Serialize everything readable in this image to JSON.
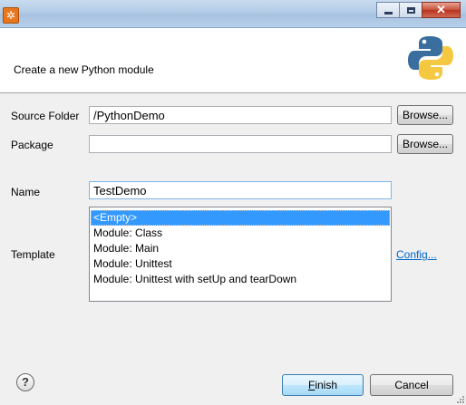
{
  "window": {
    "minimize_label": "minimize",
    "maximize_label": "maximize",
    "close_label": "close",
    "app_icon": "gear-icon"
  },
  "header": {
    "title": "Create a new Python module",
    "logo": "python-logo-icon",
    "logo_colors": {
      "blue": "#3a6e9f",
      "yellow": "#f5c842"
    }
  },
  "form": {
    "source_folder": {
      "label": "Source Folder",
      "value": "/PythonDemo",
      "browse_label": "Browse..."
    },
    "package": {
      "label": "Package",
      "value": "",
      "browse_label": "Browse..."
    },
    "name": {
      "label": "Name",
      "value": "TestDemo"
    },
    "template": {
      "label": "Template",
      "options": [
        "<Empty>",
        "Module: Class",
        "Module: Main",
        "Module: Unittest",
        "Module: Unittest with setUp and tearDown"
      ],
      "selected_index": 0,
      "config_link": "Config..."
    }
  },
  "footer": {
    "help_icon": "help-icon",
    "finish_label": "Finish",
    "cancel_label": "Cancel"
  },
  "colors": {
    "selection": "#3399ff",
    "link": "#0066cc"
  }
}
